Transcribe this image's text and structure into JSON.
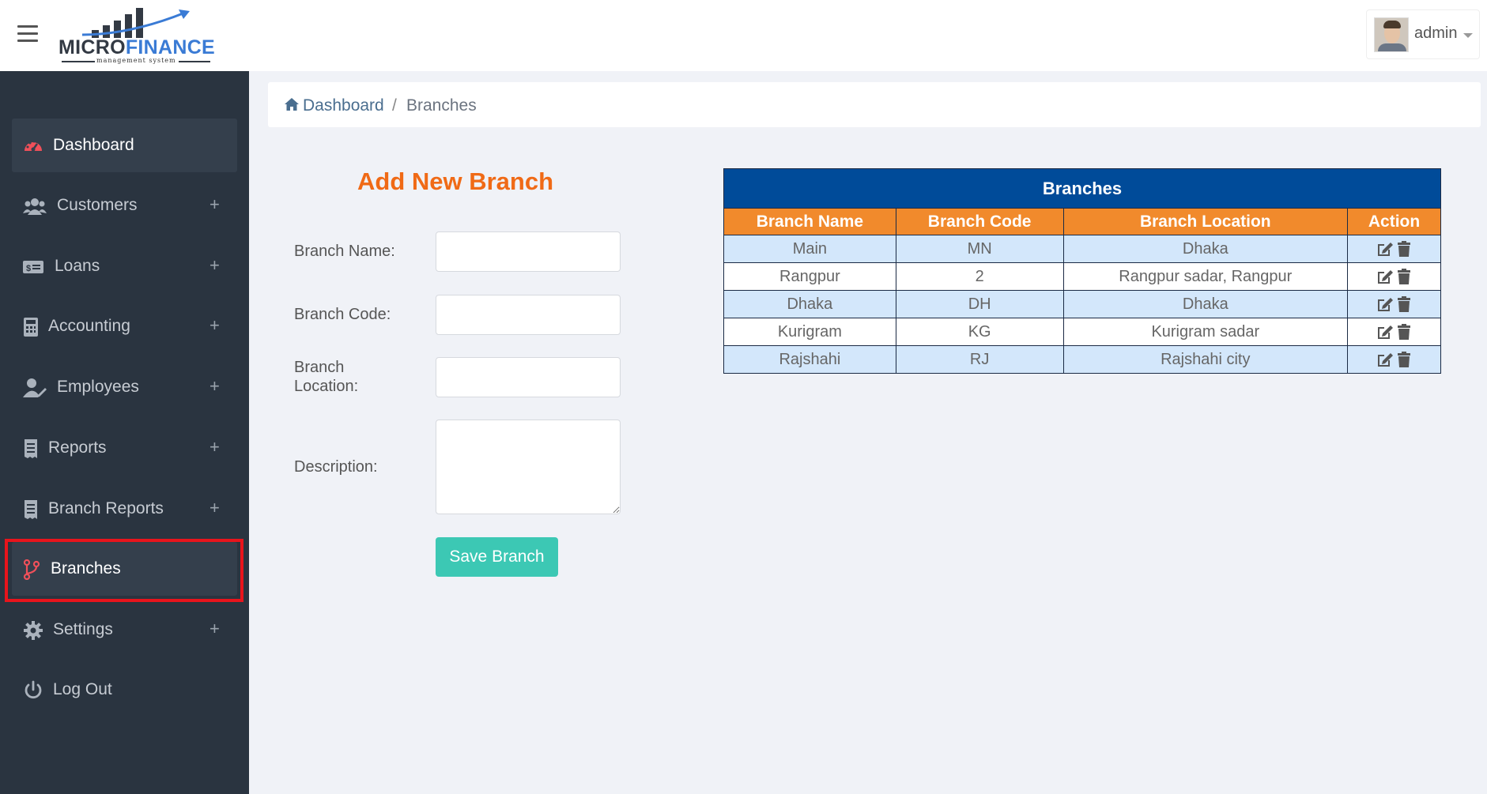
{
  "header": {
    "logo": {
      "part1": "MICRO",
      "part2": "FINANCE",
      "tagline": "management system"
    },
    "user": {
      "name": "admin"
    }
  },
  "sidebar": {
    "items": [
      {
        "label": "Dashboard",
        "icon": "tachometer-icon",
        "expandable": false,
        "active": true
      },
      {
        "label": "Customers",
        "icon": "users-icon",
        "expandable": true,
        "plus": "+"
      },
      {
        "label": "Loans",
        "icon": "money-bill-icon",
        "expandable": true,
        "plus": "+"
      },
      {
        "label": "Accounting",
        "icon": "calculator-icon",
        "expandable": true,
        "plus": "+"
      },
      {
        "label": "Employees",
        "icon": "user-edit-icon",
        "expandable": true,
        "plus": "+"
      },
      {
        "label": "Reports",
        "icon": "receipt-icon",
        "expandable": true,
        "plus": "+"
      },
      {
        "label": "Branch Reports",
        "icon": "receipt-icon",
        "expandable": true,
        "plus": "+"
      },
      {
        "label": "Branches",
        "icon": "code-branch-icon",
        "expandable": false,
        "active": true,
        "highlighted": true
      },
      {
        "label": "Settings",
        "icon": "gear-icon",
        "expandable": true,
        "plus": "+"
      },
      {
        "label": "Log Out",
        "icon": "power-icon",
        "expandable": false
      }
    ]
  },
  "breadcrumb": {
    "home": "Dashboard",
    "separator": "/",
    "current": "Branches"
  },
  "form": {
    "title": "Add New Branch",
    "fields": {
      "name_label": "Branch Name:",
      "code_label": "Branch Code:",
      "location_label_line1": "Branch",
      "location_label_line2": "Location:",
      "description_label": "Description:"
    },
    "values": {
      "name": "",
      "code": "",
      "location": "",
      "description": ""
    },
    "save_label": "Save Branch"
  },
  "table": {
    "caption": "Branches",
    "columns": [
      "Branch Name",
      "Branch Code",
      "Branch Location",
      "Action"
    ],
    "rows": [
      {
        "name": "Main",
        "code": "MN",
        "location": "Dhaka"
      },
      {
        "name": "Rangpur",
        "code": "2",
        "location": "Rangpur sadar, Rangpur"
      },
      {
        "name": "Dhaka",
        "code": "DH",
        "location": "Dhaka"
      },
      {
        "name": "Kurigram",
        "code": "KG",
        "location": "Kurigram sadar"
      },
      {
        "name": "Rajshahi",
        "code": "RJ",
        "location": "Rajshahi city"
      }
    ]
  },
  "colors": {
    "sidebar_bg": "#2a3440",
    "accent_orange": "#f06a16",
    "table_header_blue": "#004b99",
    "table_column_orange": "#f18a2c",
    "save_button": "#3cc8b4",
    "highlight_red": "#e8141c",
    "row_stripe": "#d3e7fb"
  }
}
